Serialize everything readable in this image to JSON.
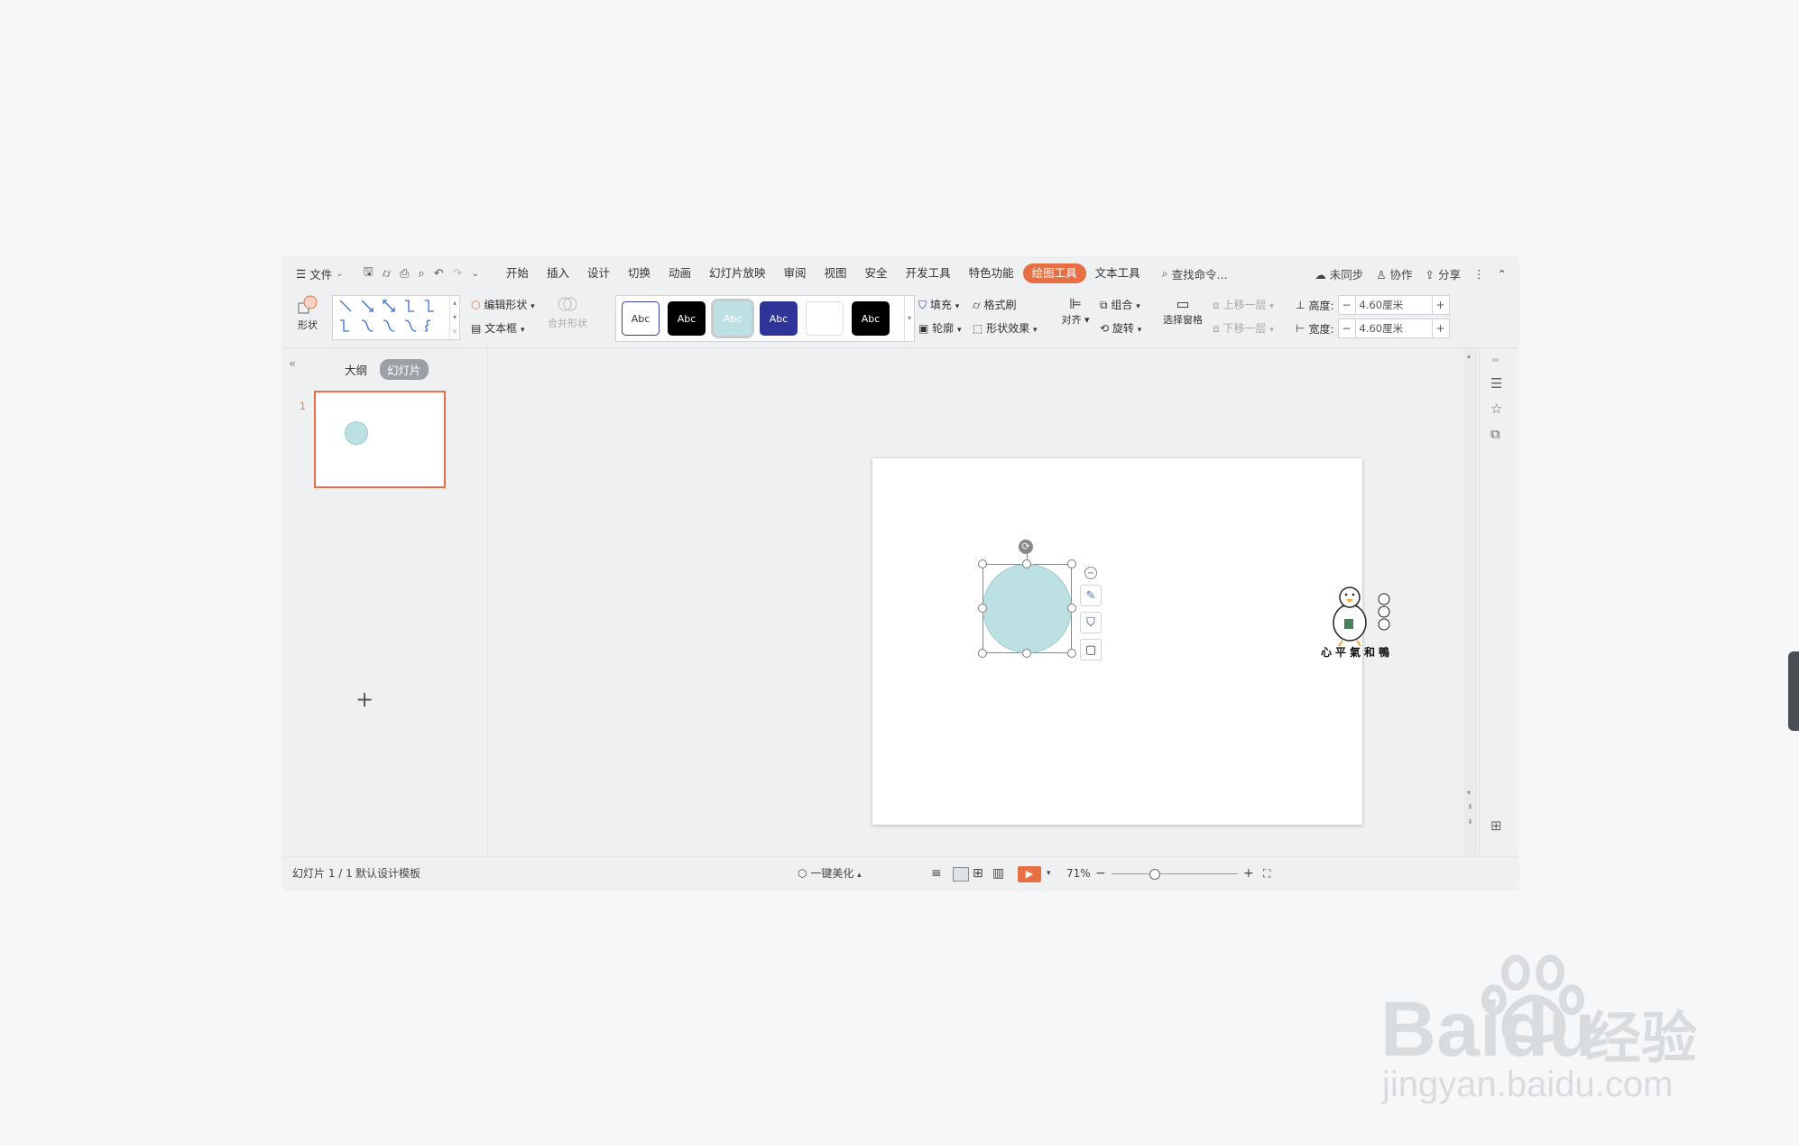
{
  "menubar": {
    "file_label": "文件",
    "tabs": [
      "开始",
      "插入",
      "设计",
      "切换",
      "动画",
      "幻灯片放映",
      "审阅",
      "视图",
      "安全",
      "开发工具",
      "特色功能",
      "绘图工具",
      "文本工具"
    ],
    "active_tab": "绘图工具",
    "search_label": "查找命令...",
    "sync_label": "未同步",
    "collab_label": "协作",
    "share_label": "分享"
  },
  "ribbon": {
    "shape_label": "形状",
    "edit_shape_label": "编辑形状",
    "textbox_label": "文本框",
    "merge_shape_label": "合并形状",
    "style_swatch_text": "Abc",
    "fill_label": "填充",
    "format_painter_label": "格式刷",
    "outline_label": "轮廓",
    "shape_effect_label": "形状效果",
    "align_label": "对齐",
    "group_label": "组合",
    "rotate_label": "旋转",
    "selection_pane_label": "选择窗格",
    "bring_forward_label": "上移一层",
    "send_backward_label": "下移一层",
    "height_label": "高度:",
    "height_value": "4.60厘米",
    "width_label": "宽度:",
    "width_value": "4.60厘米"
  },
  "left_panel": {
    "outline_tab": "大纲",
    "slides_tab": "幻灯片",
    "slide_number": "1"
  },
  "slide": {
    "shape_fill": "#bde0e3",
    "logo_text": "心平氣和鴨"
  },
  "statusbar": {
    "slide_info": "幻灯片 1 / 1",
    "template": "默认设计模板",
    "beautify": "一键美化",
    "zoom": "71%"
  },
  "watermark": {
    "brand": "Baidu",
    "cn": "经验",
    "url": "jingyan.baidu.com"
  },
  "colors": {
    "accent": "#e86f44",
    "shape": "#bde0e3"
  }
}
